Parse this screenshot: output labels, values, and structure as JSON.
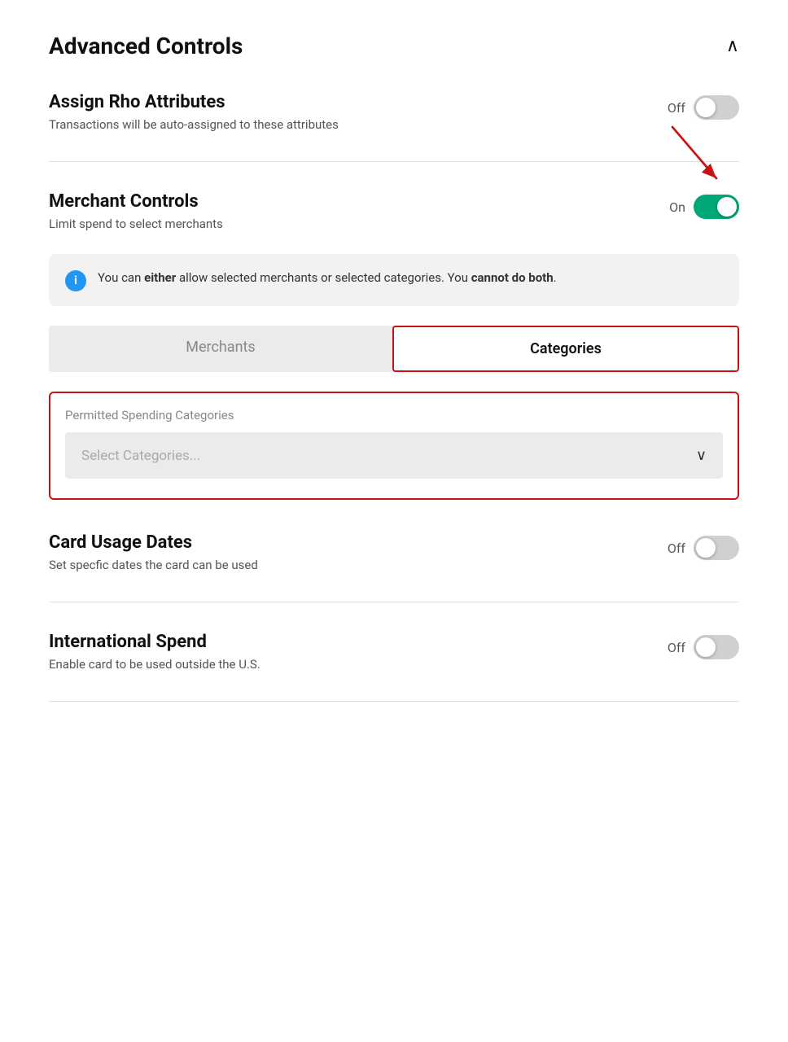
{
  "header": {
    "title": "Advanced Controls",
    "collapse_icon": "chevron-up"
  },
  "controls": [
    {
      "id": "assign-rho",
      "label": "Assign Rho Attributes",
      "description": "Transactions will be auto-assigned to these attributes",
      "state": "Off",
      "toggle_state": "off"
    },
    {
      "id": "merchant-controls",
      "label": "Merchant Controls",
      "description": "Limit spend to select merchants",
      "state": "On",
      "toggle_state": "on"
    }
  ],
  "info_box": {
    "text_html": "You can <strong>either</strong> allow selected merchants or selected categories. You <strong>cannot do both</strong>."
  },
  "tabs": [
    {
      "id": "merchants",
      "label": "Merchants",
      "active": false
    },
    {
      "id": "categories",
      "label": "Categories",
      "active": true
    }
  ],
  "categories_section": {
    "label": "Permitted Spending Categories",
    "select_placeholder": "Select Categories..."
  },
  "bottom_controls": [
    {
      "id": "card-usage-dates",
      "label": "Card Usage Dates",
      "description": "Set specfic dates the card can be used",
      "state": "Off",
      "toggle_state": "off"
    },
    {
      "id": "international-spend",
      "label": "International Spend",
      "description": "Enable card to be used outside the U.S.",
      "state": "Off",
      "toggle_state": "off"
    }
  ]
}
